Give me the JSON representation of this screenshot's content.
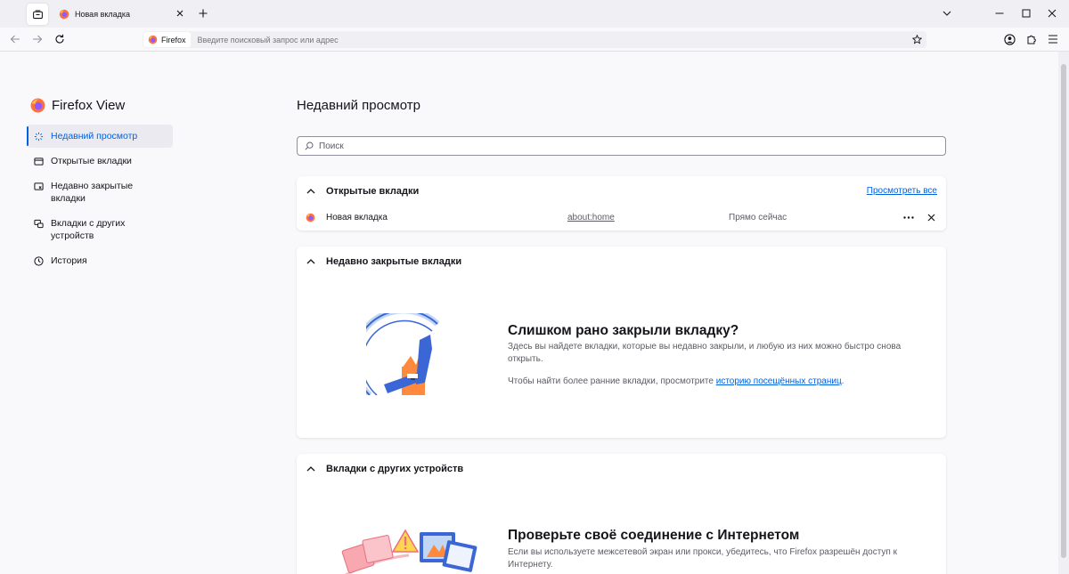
{
  "tabstrip": {
    "tab_title": "Новая вкладка"
  },
  "navbar": {
    "identity_label": "Firefox",
    "url_placeholder": "Введите поисковый запрос или адрес"
  },
  "sidebar": {
    "brand": "Firefox View",
    "items": [
      {
        "label": "Недавний просмотр",
        "icon": "recent-browsing-icon",
        "active": true
      },
      {
        "label": "Открытые вкладки",
        "icon": "open-tabs-icon"
      },
      {
        "label": "Недавно закрытые вкладки",
        "icon": "closed-tabs-icon"
      },
      {
        "label": "Вкладки с других устройств",
        "icon": "synced-tabs-icon"
      },
      {
        "label": "История",
        "icon": "history-icon"
      }
    ]
  },
  "main": {
    "title": "Недавний просмотр",
    "search_placeholder": "Поиск",
    "open_tabs": {
      "title": "Открытые вкладки",
      "view_all": "Просмотреть все",
      "rows": [
        {
          "title": "Новая вкладка",
          "url": "about:home",
          "time": "Прямо сейчас"
        }
      ]
    },
    "recently_closed": {
      "title": "Недавно закрытые вкладки",
      "heading": "Слишком рано закрыли вкладку?",
      "desc1": "Здесь вы найдете вкладки, которые вы недавно закрыли, и любую из них можно быстро снова открыть.",
      "desc2_prefix": "Чтобы найти более ранние вкладки, просмотрите ",
      "desc2_link": "историю посещённых страниц",
      "desc2_suffix": "."
    },
    "other_devices": {
      "title": "Вкладки с других устройств",
      "heading": "Проверьте своё соединение с Интернетом",
      "desc": "Если вы используете межсетевой экран или прокси, убедитесь, что Firefox разрешён доступ к Интернету."
    }
  },
  "colors": {
    "accent": "#0061e0",
    "firefox_orange": "#ff7139",
    "firefox_purple": "#9059ff"
  }
}
